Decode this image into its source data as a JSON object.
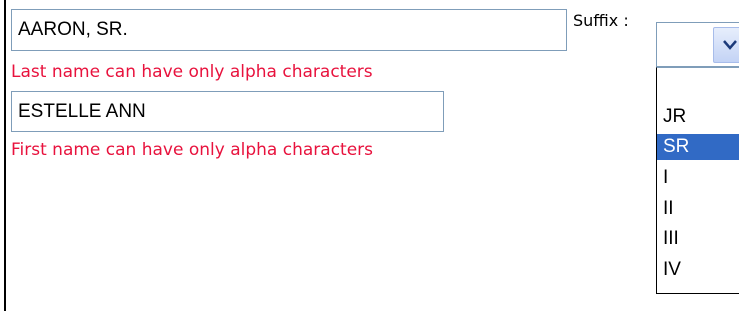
{
  "form": {
    "last_name_value": "AARON, SR.",
    "last_name_error": "Last name can have only alpha characters",
    "first_name_value": "ESTELLE ANN",
    "first_name_error": "First name can have only alpha characters",
    "suffix_label": "Suffix :",
    "suffix_selected": "",
    "suffix_options": [
      "",
      "JR",
      "SR",
      "I",
      "II",
      "III",
      "IV"
    ],
    "suffix_highlighted": "SR"
  },
  "colors": {
    "error_text": "#e8123d",
    "selection_bg": "#316ac5",
    "input_border": "#7f9db9"
  },
  "icons": {
    "dropdown_arrow": "chevron-down-icon"
  }
}
